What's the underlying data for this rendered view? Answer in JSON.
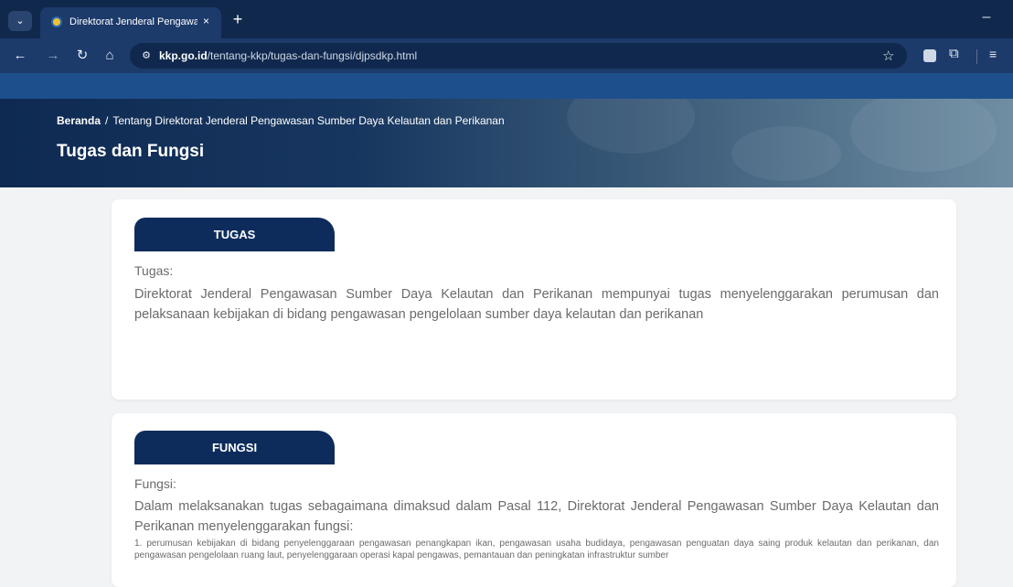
{
  "browser": {
    "tab_title": "Direktorat Jenderal Pengawasan",
    "tab_close": "×",
    "new_tab": "+",
    "url_host": "kkp.go.id",
    "url_path": "/tentang-kkp/tugas-dan-fungsi/djpsdkp.html",
    "minimize": "–",
    "icons": {
      "menu": "chevron-down-icon",
      "back": "arrow-left-icon",
      "forward": "arrow-right-icon",
      "reload": "reload-icon",
      "home": "home-icon",
      "site": "site-info-icon",
      "bookmark": "star-icon",
      "extension": "extension-icon",
      "extensions": "puzzle-icon",
      "reading_list": "reading-list-icon"
    }
  },
  "hero": {
    "breadcrumb_home": "Beranda",
    "breadcrumb_sep": "/",
    "breadcrumb_current": "Tentang Direktorat Jenderal Pengawasan Sumber Daya Kelautan dan Perikanan",
    "title": "Tugas dan Fungsi"
  },
  "tugas": {
    "heading": "TUGAS",
    "label": "Tugas:",
    "text": "Direktorat Jenderal Pengawasan Sumber Daya Kelautan dan Perikanan mempunyai tugas menyelenggarakan perumusan dan pelaksanaan kebijakan di bidang pengawasan pengelolaan sumber daya kelautan dan perikanan"
  },
  "fungsi": {
    "heading": "FUNGSI",
    "label": "Fungsi:",
    "intro": "Dalam melaksanakan tugas sebagaimana dimaksud dalam Pasal 112, Direktorat Jenderal Pengawasan Sumber Daya Kelautan dan Perikanan menyelenggarakan fungsi:",
    "items": [
      "1. perumusan kebijakan di bidang penyelenggaraan pengawasan penangkapan ikan, pengawasan usaha budidaya, pengawasan penguatan daya saing produk kelautan dan perikanan, dan pengawasan pengelolaan ruang laut, penyelenggaraan operasi kapal pengawas, pemantauan dan peningkatan infrastruktur sumber"
    ]
  },
  "colors": {
    "chrome_dark": "#11284d",
    "chrome_toolbar": "#1c3a6a",
    "accent_navy": "#0d2c5c",
    "page_bg": "#f2f3f5",
    "body_text": "#6b6b6b"
  }
}
